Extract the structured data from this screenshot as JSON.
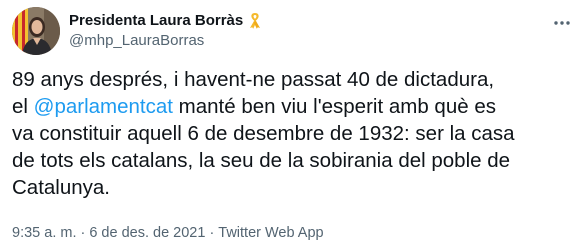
{
  "author": {
    "display_name": "Presidenta Laura Borràs",
    "handle": "@mhp_LauraBorras",
    "badge_icon": "yellow-ribbon-icon",
    "badge_color": "#f5b92c"
  },
  "tweet": {
    "line1": "89 anys després, i havent-ne passat 40 de dictadura,",
    "line2_pre": "el ",
    "mention": "@parlamentcat",
    "line2_post": " manté ben viu l'esperit amb què es",
    "line3": "va constituir aquell 6 de desembre de 1932: ser la casa",
    "line4": "de tots els catalans, la seu de la sobirania del poble de",
    "line5": "Catalunya."
  },
  "meta": {
    "time": "9:35 a. m.",
    "separator": "·",
    "date": "6 de des. de 2021",
    "app": "Twitter Web App"
  },
  "colors": {
    "text": "#0f1419",
    "secondary": "#536471",
    "link": "#1d9bf0"
  }
}
